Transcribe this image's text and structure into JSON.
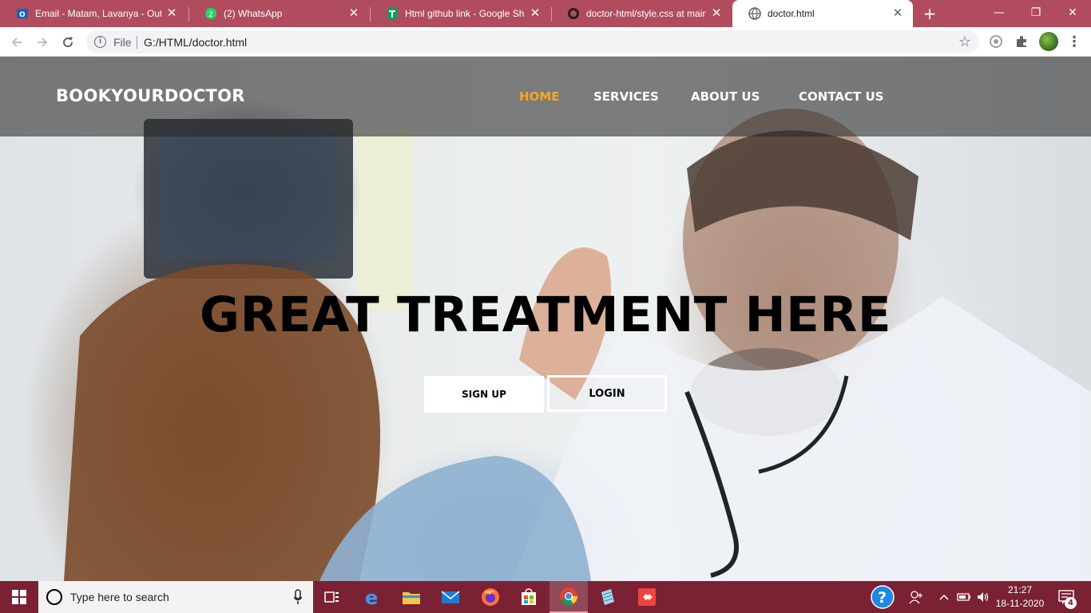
{
  "browser": {
    "tabs": [
      {
        "title": "Email - Matam, Lavanya - Outlook",
        "icon": "outlook-icon"
      },
      {
        "title": "(2) WhatsApp",
        "icon": "whatsapp-icon"
      },
      {
        "title": "Html github link - Google Sheets",
        "icon": "google-sheets-icon"
      },
      {
        "title": "doctor-html/style.css at main · ",
        "icon": "github-icon"
      },
      {
        "title": "doctor.html",
        "icon": "globe-icon",
        "active": true
      }
    ],
    "address": {
      "scheme_label": "File",
      "url": "G:/HTML/doctor.html"
    }
  },
  "site": {
    "brand": "BOOKYOURDOCTOR",
    "nav": [
      {
        "label": "HOME",
        "active": true
      },
      {
        "label": "SERVICES"
      },
      {
        "label": "ABOUT US"
      },
      {
        "label": "CONTACT US"
      }
    ],
    "hero": {
      "title": "GREAT TREATMENT HERE",
      "signup_label": "SIGN UP",
      "login_label": "LOGIN"
    },
    "colors": {
      "nav_active": "#f6a623",
      "nav_text": "#ffffff",
      "overlay": "#282828"
    }
  },
  "taskbar": {
    "search_placeholder": "Type here to search",
    "time": "21:27",
    "date": "18-11-2020",
    "notification_count": "4",
    "apps": [
      "task-view",
      "edge",
      "file-explorer",
      "mail",
      "firefox",
      "store",
      "chrome",
      "notepad",
      "anydesk"
    ],
    "color": "#7b2134"
  }
}
